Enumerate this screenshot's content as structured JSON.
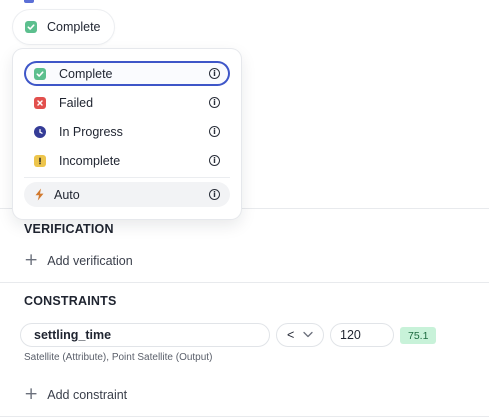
{
  "status": {
    "current_label": "Complete",
    "icon": "check-icon",
    "color": "#5cbf8e"
  },
  "menu": {
    "items": [
      {
        "label": "Complete",
        "icon": "check-icon",
        "color": "#5cbf8e",
        "selected": true
      },
      {
        "label": "Failed",
        "icon": "x-icon",
        "color": "#e2504d"
      },
      {
        "label": "In Progress",
        "icon": "clock-icon",
        "color": "#353c97"
      },
      {
        "label": "Incomplete",
        "icon": "exclamation-icon",
        "color": "#edc54c"
      }
    ],
    "auto": {
      "label": "Auto",
      "icon": "lightning-icon",
      "color": "#d1792e"
    }
  },
  "verification": {
    "title": "VERIFICATION",
    "add_label": "Add verification"
  },
  "constraints": {
    "title": "CONSTRAINTS",
    "rows": [
      {
        "attribute": "settling_time",
        "operator": "<",
        "value": "120",
        "result": "75.1",
        "source": "Satellite (Attribute), Point Satellite (Output)"
      }
    ],
    "add_label": "Add constraint"
  },
  "colors": {
    "accent": "#3e56c8",
    "result_bg": "#c8f2d9",
    "result_text": "#1c6a3f"
  }
}
